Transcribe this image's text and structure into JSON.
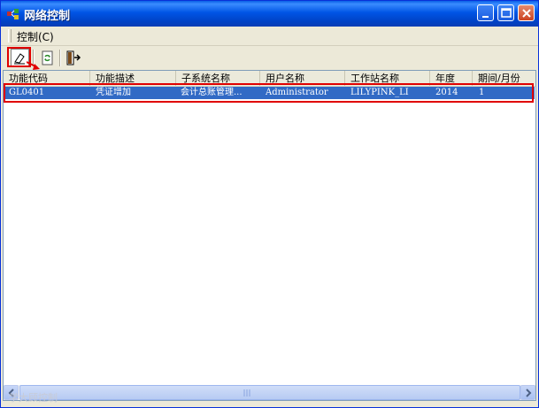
{
  "window": {
    "title": "网络控制"
  },
  "menu": {
    "items": [
      {
        "label": "控制(C)"
      }
    ]
  },
  "toolbar": {
    "buttons": [
      {
        "name": "delete-task",
        "icon": "eraser-icon"
      },
      {
        "name": "refresh",
        "icon": "refresh-icon"
      },
      {
        "name": "exit",
        "icon": "exit-door-icon"
      }
    ]
  },
  "table": {
    "columns": [
      "功能代码",
      "功能描述",
      "子系统名称",
      "用户名称",
      "工作站名称",
      "年度",
      "期间/月份"
    ],
    "rows": [
      [
        "GL0401",
        "凭证增加",
        "会计总账管理...",
        "Administrator",
        "LILYPINK_LI",
        "2014",
        "1"
      ]
    ]
  },
  "watermark": "学大顾控制",
  "colors": {
    "title_bar": "#0055e5",
    "selection": "#316ac5",
    "highlight": "#e00000"
  }
}
